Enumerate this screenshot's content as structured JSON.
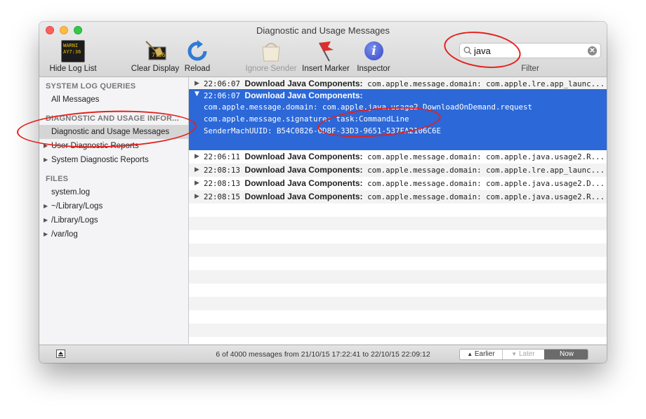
{
  "window": {
    "title": "Diagnostic and Usage Messages"
  },
  "toolbar": {
    "hide_log_list": {
      "label": "Hide Log List",
      "icon": "console-warning-icon",
      "icon_text": [
        "WARNI",
        "AY7:36"
      ]
    },
    "clear_display": {
      "label": "Clear Display",
      "icon": "broom-icon",
      "icon_text": "7:36"
    },
    "reload": {
      "label": "Reload",
      "icon": "reload-icon"
    },
    "ignore_sender": {
      "label": "Ignore Sender",
      "icon": "ignore-sender-icon"
    },
    "insert_marker": {
      "label": "Insert Marker",
      "icon": "flag-icon"
    },
    "inspector": {
      "label": "Inspector",
      "icon": "info-icon",
      "icon_text": "i"
    }
  },
  "search": {
    "value": "java",
    "placeholder": "Search",
    "filter_label": "Filter"
  },
  "sidebar": {
    "section_system": "SYSTEM LOG QUERIES",
    "all_messages": "All Messages",
    "section_diagnostic": "DIAGNOSTIC AND USAGE INFOR...",
    "diagnostic_usage": "Diagnostic and Usage Messages",
    "user_reports": "User Diagnostic Reports",
    "system_reports": "System Diagnostic Reports",
    "section_files": "FILES",
    "system_log": "system.log",
    "library_logs_user": "~/Library/Logs",
    "library_logs": "/Library/Logs",
    "var_log": "/var/log"
  },
  "messages": [
    {
      "time": "22:06:07",
      "sender": "Download Java Components:",
      "text": "com.apple.message.domain: com.apple.lre.app_launc..."
    },
    {
      "time": "22:06:07",
      "sender": "Download Java Components:",
      "details": [
        "com.apple.message.domain: com.apple.java.usage2.DownloadOnDemand.request",
        "com.apple.message.signature: task:CommandLine",
        "SenderMachUUID: B54C0826-0D8F-33D3-9651-537FA2106C6E"
      ]
    },
    {
      "time": "22:06:11",
      "sender": "Download Java Components:",
      "text": "com.apple.message.domain: com.apple.java.usage2.R..."
    },
    {
      "time": "22:08:13",
      "sender": "Download Java Components:",
      "text": "com.apple.message.domain: com.apple.lre.app_launc..."
    },
    {
      "time": "22:08:13",
      "sender": "Download Java Components:",
      "text": "com.apple.message.domain: com.apple.java.usage2.D..."
    },
    {
      "time": "22:08:15",
      "sender": "Download Java Components:",
      "text": "com.apple.message.domain: com.apple.java.usage2.R..."
    }
  ],
  "status": {
    "text": "6 of 4000 messages from 21/10/15 17:22:41 to 22/10/15 22:09:12",
    "earlier": "Earlier",
    "later": "Later",
    "now": "Now"
  },
  "colors": {
    "selection": "#2c68d8",
    "annotation": "#e4211c",
    "sidebar_selected": "#d5d5d5"
  }
}
